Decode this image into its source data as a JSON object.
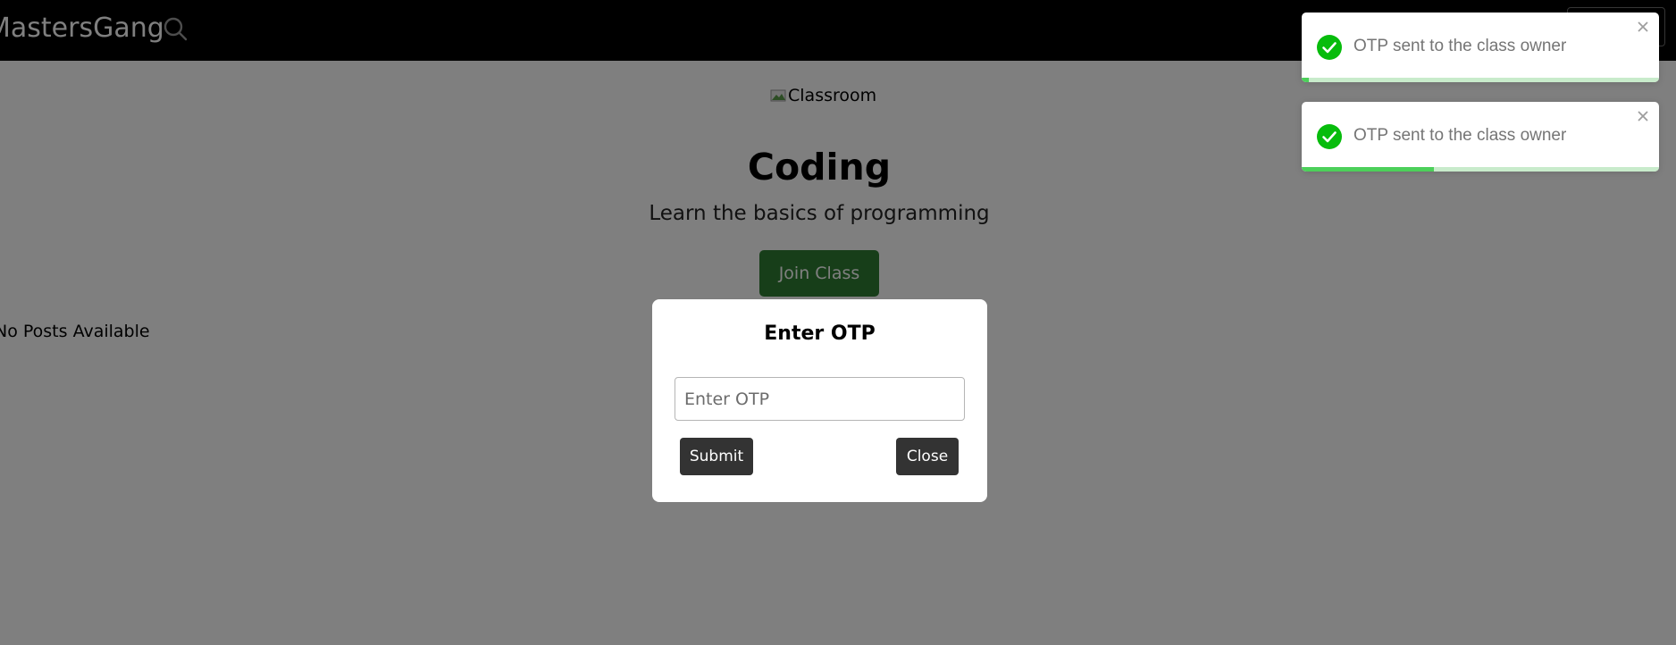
{
  "navbar": {
    "brand": "MastersGang",
    "search_icon": "search-icon"
  },
  "class_info": {
    "image_alt": "Classroom",
    "title": "Coding",
    "description": "Learn the basics of programming",
    "join_label": "Join Class"
  },
  "posts": {
    "empty_text": "No Posts Available"
  },
  "modal": {
    "title": "Enter OTP",
    "input_placeholder": "Enter OTP",
    "input_value": "",
    "submit_label": "Submit",
    "close_label": "Close"
  },
  "toasts": [
    {
      "message": "OTP sent to the class owner",
      "progress": 0.02,
      "icon": "check-circle-icon"
    },
    {
      "message": "OTP sent to the class owner",
      "progress": 0.37,
      "icon": "check-circle-icon"
    }
  ],
  "colors": {
    "navbar_bg": "#000000",
    "join_button": "#2e7d32",
    "modal_button": "#333333",
    "toast_success": "#07bc0c",
    "toast_progress": "#4cd05a"
  }
}
